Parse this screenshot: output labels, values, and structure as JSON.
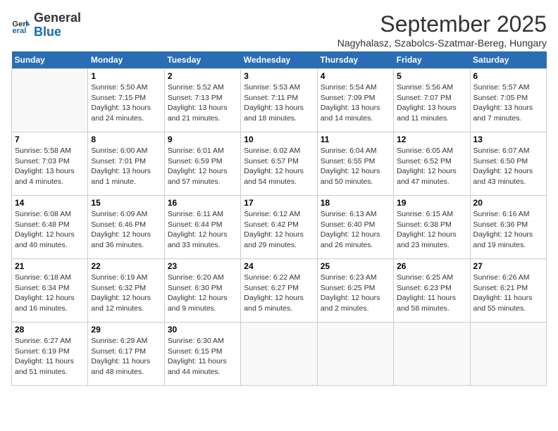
{
  "header": {
    "logo_line1": "General",
    "logo_line2": "Blue",
    "month": "September 2025",
    "location": "Nagyhalasz, Szabolcs-Szatmar-Bereg, Hungary"
  },
  "days_of_week": [
    "Sunday",
    "Monday",
    "Tuesday",
    "Wednesday",
    "Thursday",
    "Friday",
    "Saturday"
  ],
  "weeks": [
    [
      {
        "day": "",
        "content": ""
      },
      {
        "day": "1",
        "content": "Sunrise: 5:50 AM\nSunset: 7:15 PM\nDaylight: 13 hours and 24 minutes."
      },
      {
        "day": "2",
        "content": "Sunrise: 5:52 AM\nSunset: 7:13 PM\nDaylight: 13 hours and 21 minutes."
      },
      {
        "day": "3",
        "content": "Sunrise: 5:53 AM\nSunset: 7:11 PM\nDaylight: 13 hours and 18 minutes."
      },
      {
        "day": "4",
        "content": "Sunrise: 5:54 AM\nSunset: 7:09 PM\nDaylight: 13 hours and 14 minutes."
      },
      {
        "day": "5",
        "content": "Sunrise: 5:56 AM\nSunset: 7:07 PM\nDaylight: 13 hours and 11 minutes."
      },
      {
        "day": "6",
        "content": "Sunrise: 5:57 AM\nSunset: 7:05 PM\nDaylight: 13 hours and 7 minutes."
      }
    ],
    [
      {
        "day": "7",
        "content": "Sunrise: 5:58 AM\nSunset: 7:03 PM\nDaylight: 13 hours and 4 minutes."
      },
      {
        "day": "8",
        "content": "Sunrise: 6:00 AM\nSunset: 7:01 PM\nDaylight: 13 hours and 1 minute."
      },
      {
        "day": "9",
        "content": "Sunrise: 6:01 AM\nSunset: 6:59 PM\nDaylight: 12 hours and 57 minutes."
      },
      {
        "day": "10",
        "content": "Sunrise: 6:02 AM\nSunset: 6:57 PM\nDaylight: 12 hours and 54 minutes."
      },
      {
        "day": "11",
        "content": "Sunrise: 6:04 AM\nSunset: 6:55 PM\nDaylight: 12 hours and 50 minutes."
      },
      {
        "day": "12",
        "content": "Sunrise: 6:05 AM\nSunset: 6:52 PM\nDaylight: 12 hours and 47 minutes."
      },
      {
        "day": "13",
        "content": "Sunrise: 6:07 AM\nSunset: 6:50 PM\nDaylight: 12 hours and 43 minutes."
      }
    ],
    [
      {
        "day": "14",
        "content": "Sunrise: 6:08 AM\nSunset: 6:48 PM\nDaylight: 12 hours and 40 minutes."
      },
      {
        "day": "15",
        "content": "Sunrise: 6:09 AM\nSunset: 6:46 PM\nDaylight: 12 hours and 36 minutes."
      },
      {
        "day": "16",
        "content": "Sunrise: 6:11 AM\nSunset: 6:44 PM\nDaylight: 12 hours and 33 minutes."
      },
      {
        "day": "17",
        "content": "Sunrise: 6:12 AM\nSunset: 6:42 PM\nDaylight: 12 hours and 29 minutes."
      },
      {
        "day": "18",
        "content": "Sunrise: 6:13 AM\nSunset: 6:40 PM\nDaylight: 12 hours and 26 minutes."
      },
      {
        "day": "19",
        "content": "Sunrise: 6:15 AM\nSunset: 6:38 PM\nDaylight: 12 hours and 23 minutes."
      },
      {
        "day": "20",
        "content": "Sunrise: 6:16 AM\nSunset: 6:36 PM\nDaylight: 12 hours and 19 minutes."
      }
    ],
    [
      {
        "day": "21",
        "content": "Sunrise: 6:18 AM\nSunset: 6:34 PM\nDaylight: 12 hours and 16 minutes."
      },
      {
        "day": "22",
        "content": "Sunrise: 6:19 AM\nSunset: 6:32 PM\nDaylight: 12 hours and 12 minutes."
      },
      {
        "day": "23",
        "content": "Sunrise: 6:20 AM\nSunset: 6:30 PM\nDaylight: 12 hours and 9 minutes."
      },
      {
        "day": "24",
        "content": "Sunrise: 6:22 AM\nSunset: 6:27 PM\nDaylight: 12 hours and 5 minutes."
      },
      {
        "day": "25",
        "content": "Sunrise: 6:23 AM\nSunset: 6:25 PM\nDaylight: 12 hours and 2 minutes."
      },
      {
        "day": "26",
        "content": "Sunrise: 6:25 AM\nSunset: 6:23 PM\nDaylight: 11 hours and 58 minutes."
      },
      {
        "day": "27",
        "content": "Sunrise: 6:26 AM\nSunset: 6:21 PM\nDaylight: 11 hours and 55 minutes."
      }
    ],
    [
      {
        "day": "28",
        "content": "Sunrise: 6:27 AM\nSunset: 6:19 PM\nDaylight: 11 hours and 51 minutes."
      },
      {
        "day": "29",
        "content": "Sunrise: 6:29 AM\nSunset: 6:17 PM\nDaylight: 11 hours and 48 minutes."
      },
      {
        "day": "30",
        "content": "Sunrise: 6:30 AM\nSunset: 6:15 PM\nDaylight: 11 hours and 44 minutes."
      },
      {
        "day": "",
        "content": ""
      },
      {
        "day": "",
        "content": ""
      },
      {
        "day": "",
        "content": ""
      },
      {
        "day": "",
        "content": ""
      }
    ]
  ]
}
